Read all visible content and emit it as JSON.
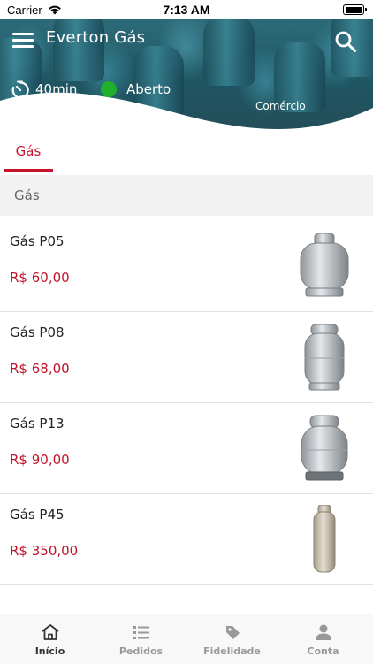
{
  "status_bar": {
    "carrier": "Carrier",
    "time": "7:13 AM"
  },
  "header": {
    "title": "Everton Gás",
    "eta": "40min",
    "status": "Aberto",
    "category": "Comércio"
  },
  "tabs": [
    {
      "label": "Gás",
      "active": true
    }
  ],
  "section": {
    "title": "Gás"
  },
  "products": [
    {
      "name": "Gás P05",
      "price": "R$ 60,00",
      "image": "gas-cylinder-p05"
    },
    {
      "name": "Gás P08",
      "price": "R$ 68,00",
      "image": "gas-cylinder-p08"
    },
    {
      "name": "Gás P13",
      "price": "R$ 90,00",
      "image": "gas-cylinder-p13"
    },
    {
      "name": "Gás P45",
      "price": "R$ 350,00",
      "image": "gas-cylinder-p45"
    }
  ],
  "bottom_nav": [
    {
      "label": "Início",
      "icon": "home-icon",
      "active": true
    },
    {
      "label": "Pedidos",
      "icon": "orders-list-icon",
      "active": false
    },
    {
      "label": "Fidelidade",
      "icon": "loyalty-tag-icon",
      "active": false
    },
    {
      "label": "Conta",
      "icon": "user-icon",
      "active": false
    }
  ],
  "colors": {
    "accent": "#c8142b",
    "open": "#1faf2b",
    "header": "#2d6b78"
  }
}
